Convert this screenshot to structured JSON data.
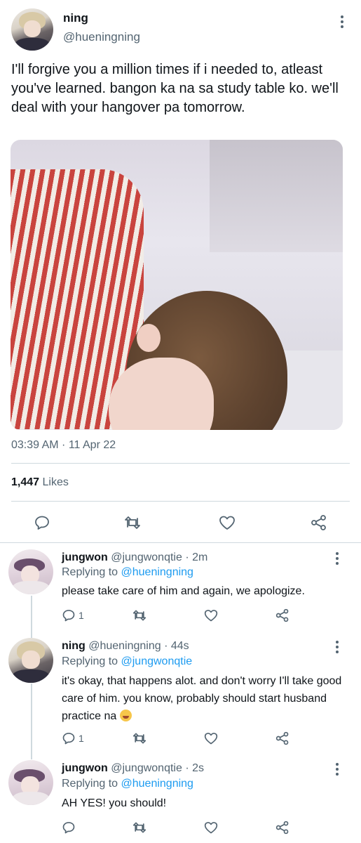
{
  "main_tweet": {
    "display_name": "ning",
    "handle": "@hueningning",
    "text": "I'll forgive you a million times if i needed to, atleast you've learned. bangon ka na sa study table ko. we'll deal with your hangover pa tomorrow.",
    "timestamp": "03:39 AM · 11 Apr 22",
    "likes_count": "1,447",
    "likes_label": "Likes",
    "photo_icon": "photo-sleeping-on-desk"
  },
  "replies": [
    {
      "display_name": "jungwon",
      "handle": "@jungwonqtie",
      "time_ago": "· 2m",
      "replying_label": "Replying to",
      "replying_to": "@hueningning",
      "text": "please take care of him and again, we apologize.",
      "reply_count": "1"
    },
    {
      "display_name": "ning",
      "handle": "@hueningning",
      "time_ago": "· 44s",
      "replying_label": "Replying to",
      "replying_to": "@jungwonqtie",
      "text": "it's okay, that happens alot. and don't worry I'll take good care of him. you know, probably should start husband practice na",
      "emoji": "grinning-sweat-emoji",
      "reply_count": "1"
    },
    {
      "display_name": "jungwon",
      "handle": "@jungwonqtie",
      "time_ago": "· 2s",
      "replying_label": "Replying to",
      "replying_to": "@hueningning",
      "text": "AH YES! you should!",
      "reply_count": ""
    }
  ],
  "icons": {
    "reply": "reply-icon",
    "retweet": "retweet-icon",
    "like": "heart-icon",
    "share": "share-icon",
    "more": "more-options-icon"
  },
  "colors": {
    "text_primary": "#0f1419",
    "text_secondary": "#536471",
    "link": "#1d9bf0",
    "divider": "#cfd9de"
  }
}
